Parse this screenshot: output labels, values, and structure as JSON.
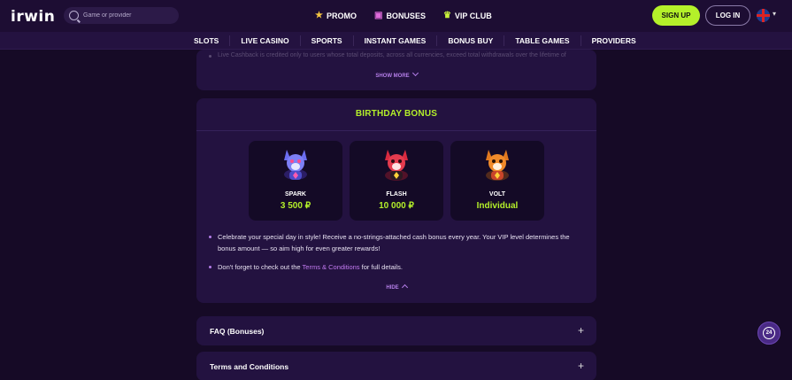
{
  "header": {
    "logo": "irwin",
    "search_placeholder": "Game or provider",
    "nav": [
      {
        "label": "PROMO",
        "icon": "star-icon"
      },
      {
        "label": "BONUSES",
        "icon": "gift-icon"
      },
      {
        "label": "VIP CLUB",
        "icon": "crown-icon"
      }
    ],
    "signup": "SIGN UP",
    "login": "LOG IN",
    "language_icon": "uk-flag-icon"
  },
  "categories": [
    "SLOTS",
    "LIVE CASINO",
    "SPORTS",
    "INSTANT GAMES",
    "BONUS BUY",
    "TABLE GAMES",
    "PROVIDERS"
  ],
  "cashback_card": {
    "faded_text": "Live Cashback is credited only to users whose total deposits, across all currencies, exceed total withdrawals over the lifetime of",
    "show_more": "SHOW MORE"
  },
  "birthday": {
    "title": "BIRTHDAY BONUS",
    "tiers": [
      {
        "name": "SPARK",
        "value": "3 500 ₽"
      },
      {
        "name": "FLASH",
        "value": "10 000 ₽"
      },
      {
        "name": "VOLT",
        "value": "Individual"
      }
    ],
    "bullet1": "Celebrate your special day in style! Receive a no-strings-attached cash bonus every year. Your VIP level determines the bonus amount — so aim high for even greater rewards!",
    "bullet2_pre": "Don't forget to check out the ",
    "bullet2_link": "Terms & Conditions",
    "bullet2_post": " for full details.",
    "hide": "HIDE"
  },
  "accordions": [
    {
      "title": "FAQ (Bonuses)",
      "toggle": "+"
    },
    {
      "title": "Terms and Conditions",
      "toggle": "+"
    }
  ],
  "support_badge": "24",
  "colors": {
    "background": "#160a26",
    "card": "#231240",
    "accent_green": "#b4f02a",
    "accent_purple": "#b47ee8"
  }
}
